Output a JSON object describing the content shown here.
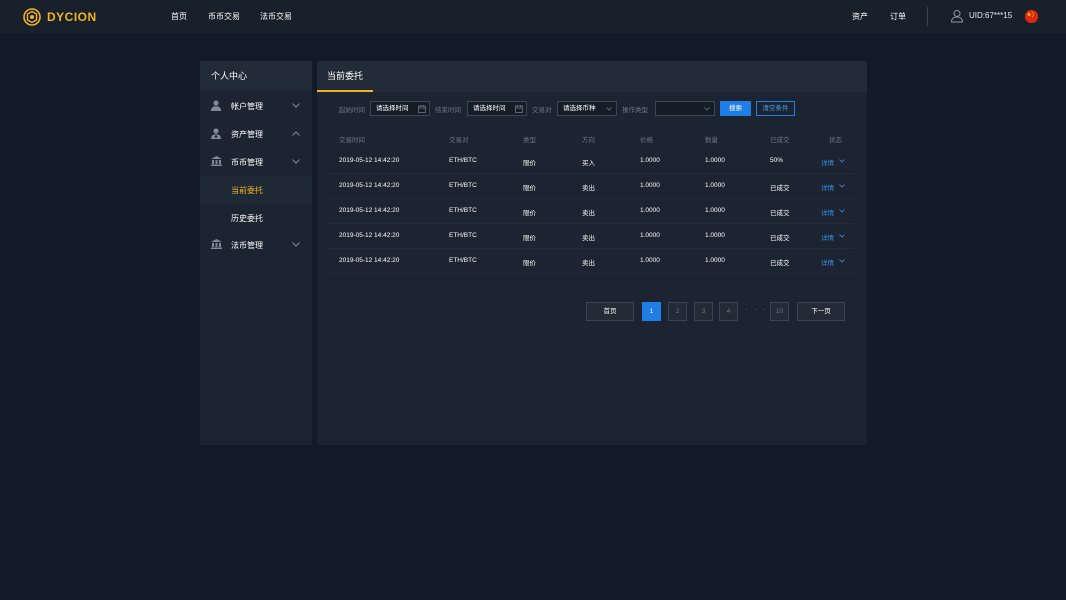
{
  "header": {
    "brand": "DYCION",
    "nav": [
      "首页",
      "币币交易",
      "法币交易"
    ],
    "assets": "资产",
    "orders": "订单",
    "uid": "UID:67***15",
    "flag": "china-flag-icon"
  },
  "sidebar": {
    "title": "个人中心",
    "items": [
      {
        "label": "帐户管理",
        "icon": "user-icon",
        "chevron": "down"
      },
      {
        "label": "资产管理",
        "icon": "wallet-user-icon",
        "chevron": "up"
      },
      {
        "label": "币币管理",
        "icon": "bank-icon",
        "chevron": "down"
      },
      {
        "label": "当前委托",
        "active": true
      },
      {
        "label": "历史委托"
      },
      {
        "label": "法币管理",
        "icon": "bank-icon",
        "chevron": "down"
      }
    ]
  },
  "main": {
    "tab": "当前委托",
    "filters": {
      "start_label": "起始时间",
      "start_placeholder": "请选择时间",
      "end_label": "结束时间",
      "end_placeholder": "请选择时间",
      "pair_label": "交易对",
      "pair_placeholder": "请选择币种",
      "type_label": "操作类型",
      "type_value": "",
      "search": "搜索",
      "clear": "清空条件"
    },
    "columns": [
      "交易时间",
      "交易对",
      "类型",
      "方向",
      "价格",
      "数量",
      "已成交",
      "状态"
    ],
    "rows": [
      {
        "time": "2019-05-12 14:42:20",
        "pair": "ETH/BTC",
        "type": "限价",
        "side": "买入",
        "price": "1.0000",
        "qty": "1.0000",
        "filled": "50%",
        "status": "详情"
      },
      {
        "time": "2019-05-12 14:42:20",
        "pair": "ETH/BTC",
        "type": "限价",
        "side": "卖出",
        "price": "1.0000",
        "qty": "1.0000",
        "filled": "已成交",
        "status": "详情"
      },
      {
        "time": "2019-05-12 14:42:20",
        "pair": "ETH/BTC",
        "type": "限价",
        "side": "卖出",
        "price": "1.0000",
        "qty": "1.0000",
        "filled": "已成交",
        "status": "详情"
      },
      {
        "time": "2019-05-12 14:42:20",
        "pair": "ETH/BTC",
        "type": "限价",
        "side": "卖出",
        "price": "1.0000",
        "qty": "1.0000",
        "filled": "已成交",
        "status": "详情"
      },
      {
        "time": "2019-05-12 14:42:20",
        "pair": "ETH/BTC",
        "type": "限价",
        "side": "卖出",
        "price": "1.0000",
        "qty": "1.0000",
        "filled": "已成交",
        "status": "详情"
      }
    ],
    "pagination": {
      "first": "首页",
      "pages": [
        "1",
        "2",
        "3",
        "4"
      ],
      "dots": "· · ·",
      "last": "10",
      "next": "下一页"
    }
  },
  "colors": {
    "background": "#111a26",
    "panel": "#1b2430",
    "accent": "#f2b31c",
    "link": "#1f7ee6"
  }
}
